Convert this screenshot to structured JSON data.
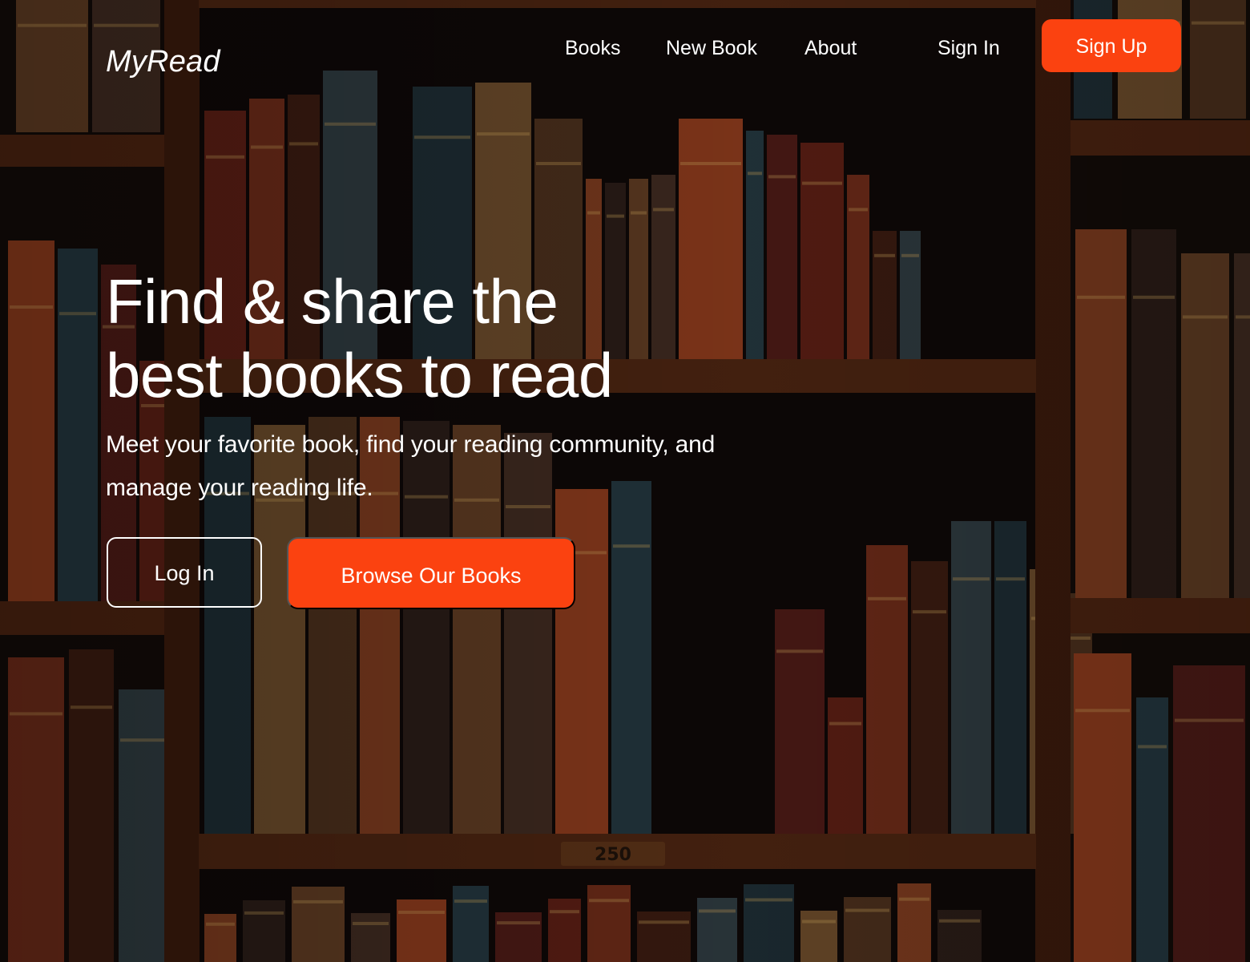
{
  "brand": {
    "logo_text": "MyRead",
    "accent_color": "#fb4210"
  },
  "nav": {
    "items": [
      {
        "label": "Books"
      },
      {
        "label": "New Book"
      },
      {
        "label": "About"
      }
    ],
    "sign_in_label": "Sign In",
    "sign_up_label": "Sign Up"
  },
  "hero": {
    "headline_line1": "Find & share the",
    "headline_line2": "best books to read",
    "subtitle": "Meet your favorite book, find your reading community, and manage your reading life.",
    "login_label": "Log In",
    "browse_label": "Browse Our Books",
    "background": "bookshelf-photo",
    "shelf_label": "250"
  }
}
